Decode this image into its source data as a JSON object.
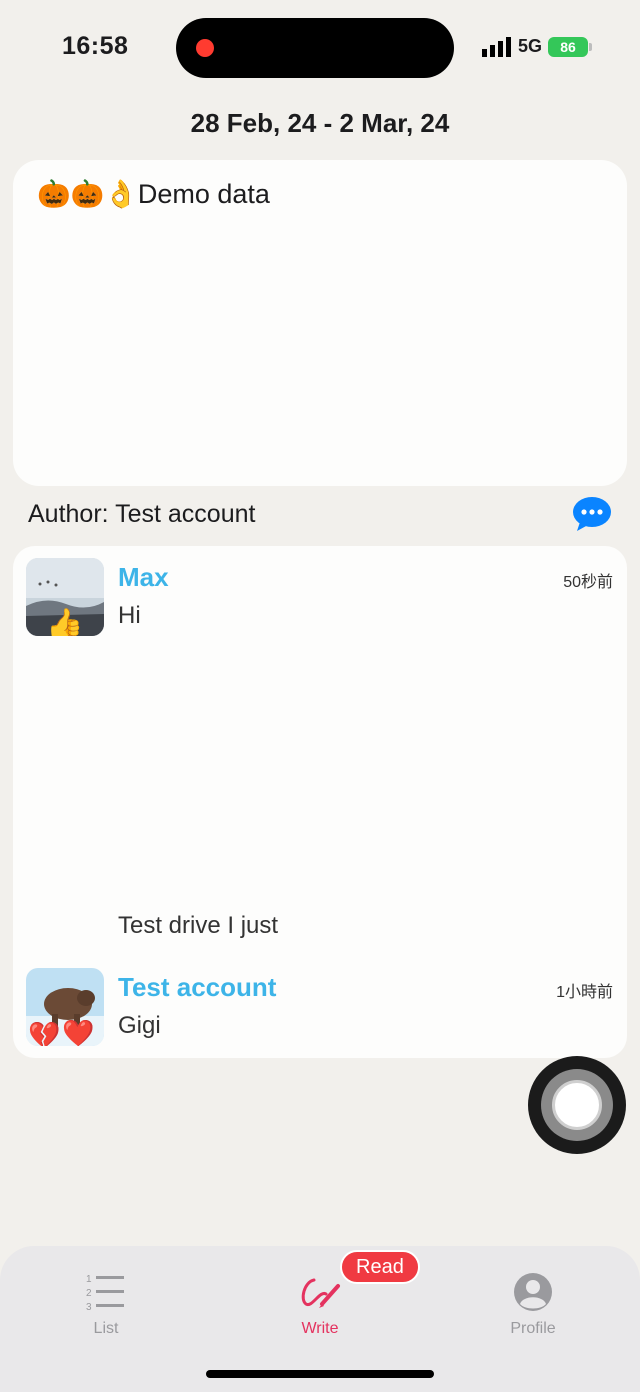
{
  "status_bar": {
    "time": "16:58",
    "network": "5G",
    "battery": "86"
  },
  "header": {
    "date_range": "28 Feb, 24 - 2 Mar, 24"
  },
  "post": {
    "text": "🎃🎃👌Demo data",
    "author": "Author: Test account"
  },
  "comments": [
    {
      "name": "Max",
      "time": "50秒前",
      "lines": [
        "Hi",
        "Test drive I just"
      ]
    },
    {
      "name": "Test account",
      "time": "1小時前",
      "lines": [
        "Gigi"
      ]
    }
  ],
  "tabs": [
    {
      "label": "List",
      "icon": "list-icon"
    },
    {
      "label": "Write",
      "icon": "pen-icon",
      "badge": "Read"
    },
    {
      "label": "Profile",
      "icon": "person-icon"
    }
  ],
  "colors": {
    "accent": "#e4325f",
    "name": "#3db4e8",
    "badge": "#f03a42",
    "battery": "#34c759",
    "comment_icon": "#0a84ff"
  }
}
